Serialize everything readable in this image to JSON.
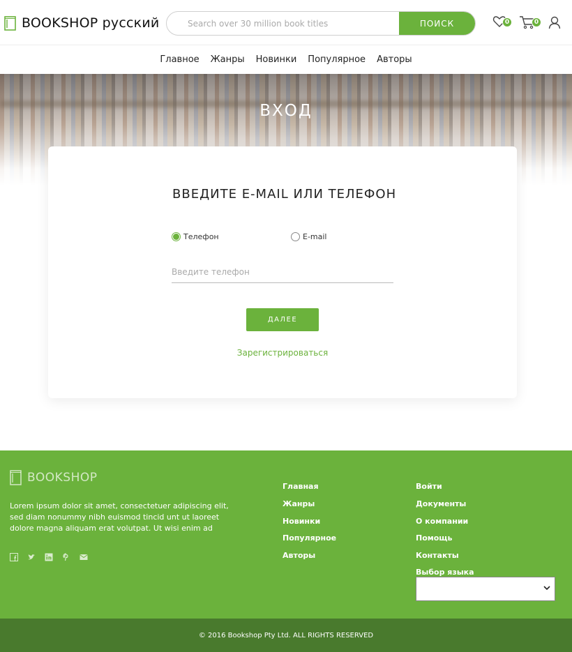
{
  "header": {
    "logo_text": "BOOKSHOP русский",
    "search_placeholder": "Search over 30 million book titles",
    "search_button": "ПОИСК",
    "favorites_count": "0",
    "cart_count": "0"
  },
  "nav": {
    "items": [
      "Главное",
      "Жанры",
      "Новинки",
      "Популярное",
      "Авторы"
    ]
  },
  "hero": {
    "title": "ВХОД"
  },
  "login": {
    "title": "ВВЕДИТЕ E-MAIL ИЛИ ТЕЛЕФОН",
    "option_phone": "Телефон",
    "option_email": "E-mail",
    "selected": "phone",
    "phone_placeholder": "Введите телефон",
    "next_button": "ДАЛЕЕ",
    "register_link": "Зарегистрироваться"
  },
  "footer": {
    "logo_text": "BOOKSHOP",
    "description": "Lorem ipsum dolor sit amet, consectetuer adipiscing elit, sed diam nonummy nibh euismod tincid unt ut laoreet dolore magna aliquam erat volutpat. Ut wisi enim ad",
    "social_icons": [
      "facebook-icon",
      "twitter-icon",
      "linkedin-icon",
      "pinterest-icon",
      "mail-icon"
    ],
    "col1": [
      "Главная",
      "Жанры",
      "Новинки",
      "Популярное",
      "Авторы"
    ],
    "col2": [
      "Войти",
      "Документы",
      "О компании",
      "Помощь",
      "Контакты"
    ],
    "language_label": "Выбор языка",
    "language_value": "",
    "copyright": "© 2016 Bookshop Pty Ltd. ALL RIGHTS RESERVED"
  },
  "colors": {
    "accent": "#6bb23c",
    "footer_dark": "#497a2d"
  }
}
